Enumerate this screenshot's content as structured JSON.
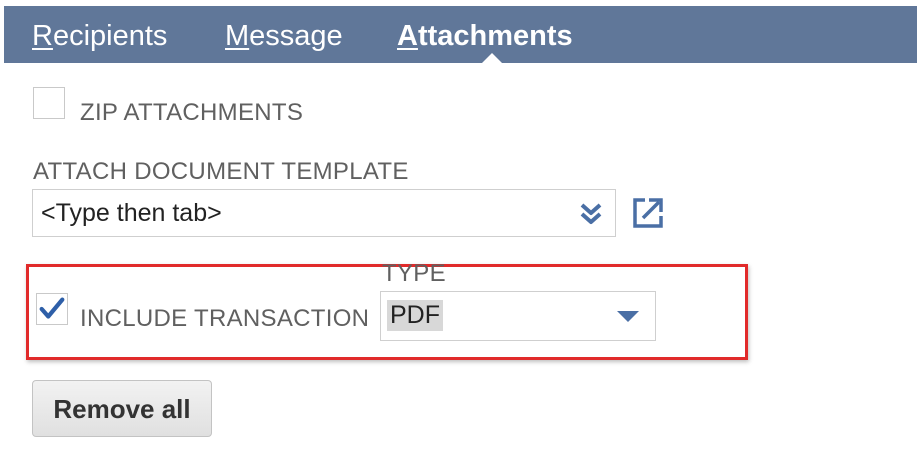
{
  "tabs": {
    "recipients": {
      "accel": "R",
      "rest": "ecipients"
    },
    "message": {
      "accel": "M",
      "rest": "essage"
    },
    "attachments": {
      "accel": "A",
      "rest": "ttachments"
    }
  },
  "zip_attachments": {
    "label": "ZIP ATTACHMENTS",
    "checked": false
  },
  "document_template": {
    "label": "ATTACH DOCUMENT TEMPLATE",
    "value": "<Type then tab>"
  },
  "include_transaction": {
    "label": "INCLUDE TRANSACTION",
    "checked": true
  },
  "type_field": {
    "label": "TYPE",
    "value": "PDF"
  },
  "remove_all": {
    "label": "Remove all"
  },
  "colors": {
    "tab_bar": "#607799",
    "accent_blue": "#4a6fa5",
    "highlight_red": "#e12a2a"
  },
  "icons": {
    "combo_arrow": "double-chevron-down-icon",
    "open": "open-external-icon",
    "check": "checkmark-icon",
    "caret": "caret-down-icon"
  }
}
